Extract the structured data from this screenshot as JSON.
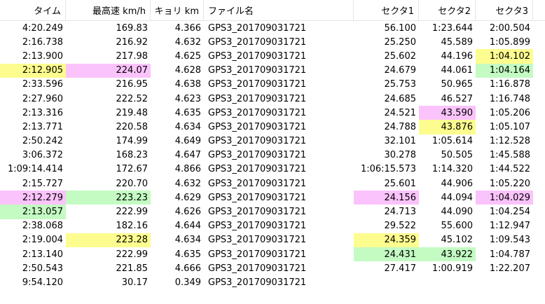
{
  "headers": [
    "タイム",
    "最高速 km/h",
    "キョリ km",
    "ファイル名",
    "セクタ1",
    "セクタ2",
    "セクタ3"
  ],
  "colors": {
    "pink": "#fbc3fb",
    "yellow": "#fdfd8f",
    "green": "#c3fbc3"
  },
  "rows": [
    [
      "4:20.249",
      "169.83",
      "4.366",
      "GPS3_201709031721",
      "56.100",
      "1:23.644",
      "2:00.504"
    ],
    [
      "2:16.738",
      "216.92",
      "4.632",
      "GPS3_201709031721",
      "25.250",
      "45.589",
      "1:05.899"
    ],
    [
      "2:13.900",
      "217.98",
      "4.625",
      "GPS3_201709031721",
      "25.602",
      "44.196",
      "1:04.102"
    ],
    [
      "2:12.905",
      "224.07",
      "4.628",
      "GPS3_201709031721",
      "24.679",
      "44.061",
      "1:04.164"
    ],
    [
      "2:33.596",
      "216.95",
      "4.638",
      "GPS3_201709031721",
      "25.753",
      "50.965",
      "1:16.878"
    ],
    [
      "2:27.960",
      "222.52",
      "4.623",
      "GPS3_201709031721",
      "24.685",
      "46.527",
      "1:16.748"
    ],
    [
      "2:13.316",
      "219.48",
      "4.635",
      "GPS3_201709031721",
      "24.521",
      "43.590",
      "1:05.206"
    ],
    [
      "2:13.771",
      "220.58",
      "4.634",
      "GPS3_201709031721",
      "24.788",
      "43.876",
      "1:05.107"
    ],
    [
      "2:50.242",
      "174.99",
      "4.649",
      "GPS3_201709031721",
      "32.101",
      "1:05.614",
      "1:12.528"
    ],
    [
      "3:06.372",
      "168.23",
      "4.647",
      "GPS3_201709031721",
      "30.278",
      "50.505",
      "1:45.588"
    ],
    [
      "1:09:14.414",
      "172.67",
      "4.866",
      "GPS3_201709031721",
      "1:06:15.573",
      "1:14.320",
      "1:44.522"
    ],
    [
      "2:15.727",
      "220.70",
      "4.632",
      "GPS3_201709031721",
      "25.601",
      "44.906",
      "1:05.220"
    ],
    [
      "2:12.279",
      "223.23",
      "4.629",
      "GPS3_201709031721",
      "24.156",
      "44.094",
      "1:04.029"
    ],
    [
      "2:13.057",
      "222.99",
      "4.626",
      "GPS3_201709031721",
      "24.713",
      "44.090",
      "1:04.254"
    ],
    [
      "2:38.068",
      "182.16",
      "4.644",
      "GPS3_201709031721",
      "29.522",
      "55.600",
      "1:12.947"
    ],
    [
      "2:19.004",
      "223.28",
      "4.634",
      "GPS3_201709031721",
      "24.359",
      "45.102",
      "1:09.543"
    ],
    [
      "2:13.140",
      "222.99",
      "4.635",
      "GPS3_201709031721",
      "24.431",
      "43.922",
      "1:04.787"
    ],
    [
      "2:50.543",
      "221.85",
      "4.666",
      "GPS3_201709031721",
      "27.417",
      "1:00.919",
      "1:22.207"
    ],
    [
      "9:54.120",
      "30.17",
      "0.349",
      "GPS3_201709031721",
      "",
      "",
      ""
    ]
  ],
  "highlights": [
    {
      "row": 2,
      "col": 6,
      "color": "yellow"
    },
    {
      "row": 3,
      "col": 0,
      "color": "yellow"
    },
    {
      "row": 3,
      "col": 1,
      "color": "pink"
    },
    {
      "row": 3,
      "col": 6,
      "color": "green"
    },
    {
      "row": 6,
      "col": 5,
      "color": "pink"
    },
    {
      "row": 7,
      "col": 5,
      "color": "yellow"
    },
    {
      "row": 12,
      "col": 0,
      "color": "pink"
    },
    {
      "row": 12,
      "col": 1,
      "color": "green"
    },
    {
      "row": 12,
      "col": 4,
      "color": "pink"
    },
    {
      "row": 12,
      "col": 6,
      "color": "pink"
    },
    {
      "row": 13,
      "col": 0,
      "color": "green"
    },
    {
      "row": 15,
      "col": 1,
      "color": "yellow"
    },
    {
      "row": 15,
      "col": 4,
      "color": "yellow"
    },
    {
      "row": 16,
      "col": 4,
      "color": "green"
    },
    {
      "row": 16,
      "col": 5,
      "color": "green"
    }
  ]
}
